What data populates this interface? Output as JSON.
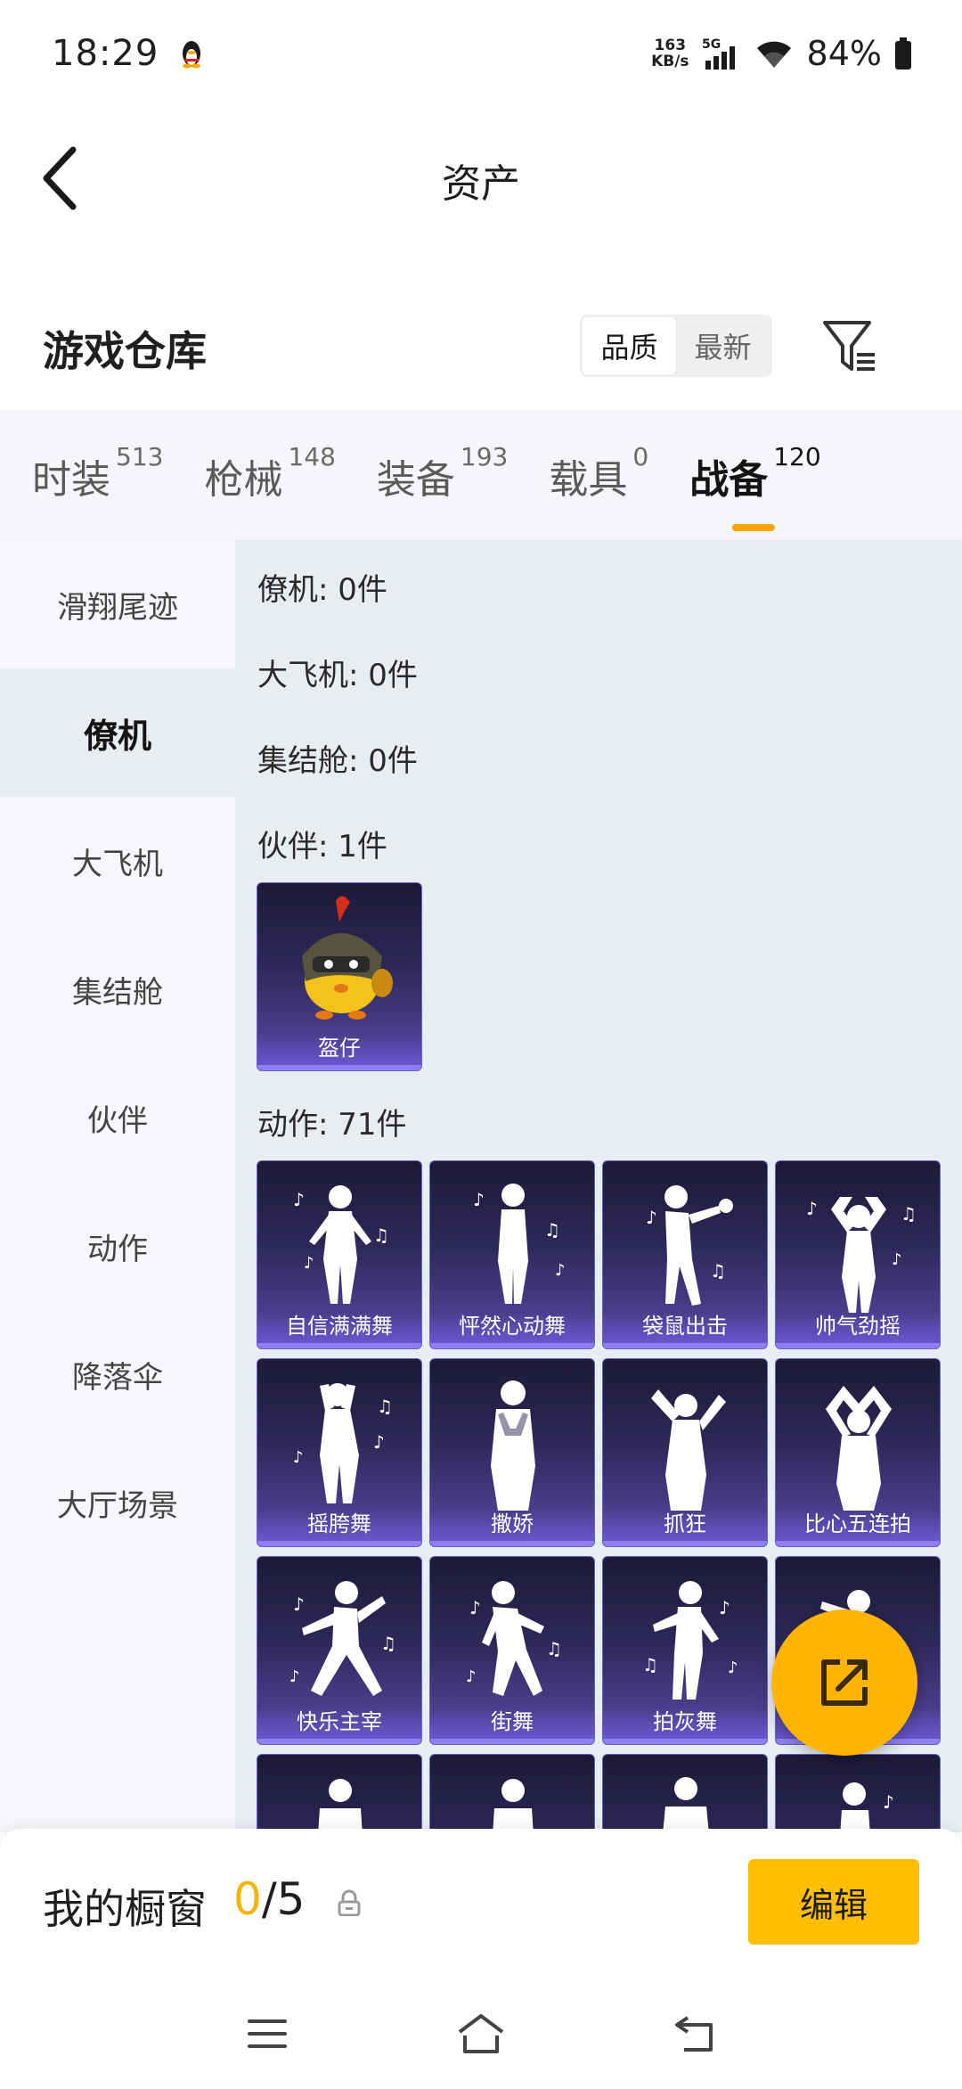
{
  "status_bar": {
    "time": "18:29",
    "net_speed_value": "163",
    "net_speed_unit": "KB/s",
    "network": "5G",
    "battery": "84%"
  },
  "header": {
    "title": "资产"
  },
  "warehouse": {
    "title": "游戏仓库",
    "sort_options": [
      "品质",
      "最新"
    ]
  },
  "category_tabs": [
    {
      "label": "时装",
      "count": "513"
    },
    {
      "label": "枪械",
      "count": "148"
    },
    {
      "label": "装备",
      "count": "193"
    },
    {
      "label": "载具",
      "count": "0"
    },
    {
      "label": "战备",
      "count": "120"
    }
  ],
  "sidebar": {
    "items": [
      "滑翔尾迹",
      "僚机",
      "大飞机",
      "集结舱",
      "伙伴",
      "动作",
      "降落伞",
      "大厅场景"
    ]
  },
  "sections": {
    "wingman": "僚机: 0件",
    "big_plane": "大飞机: 0件",
    "assembly_pod": "集结舱: 0件",
    "partner": "伙伴: 1件",
    "emote": "动作: 71件"
  },
  "partner_items": [
    "盔仔"
  ],
  "emote_items": [
    "自信满满舞",
    "怦然心动舞",
    "袋鼠出击",
    "帅气劲摇",
    "摇胯舞",
    "撒娇",
    "抓狂",
    "比心五连拍",
    "快乐主宰",
    "街舞",
    "拍灰舞"
  ],
  "showcase": {
    "title": "我的橱窗",
    "current": "0",
    "max": "/5",
    "edit_label": "编辑"
  },
  "colors": {
    "accent": "#f5a600",
    "card_top": "#1c1a36",
    "card_bottom": "#5a4aa8"
  }
}
